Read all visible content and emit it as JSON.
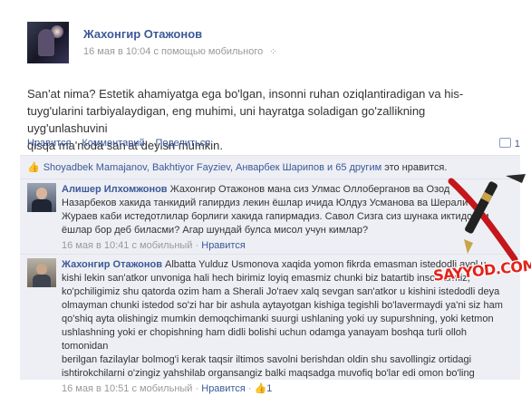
{
  "post": {
    "author": "Жахонгир Отажонов",
    "time": "16 мая в 10:04",
    "via": "с помощью мобильного",
    "text_line1": "San'at nima? Estetik ahamiyatga ega bo'lgan, insonni ruhan oziqlantiradigan va his-",
    "text_line2": "tuyg'ularini tarbiyalaydigan, eng muhimi, uni hayratga soladigan go'zallikning uyg'unlashuvini",
    "text_line3": "qisqa ma'noda san'at deyish mumkin."
  },
  "actions": {
    "like": "Нравится",
    "comment": "Комментарий",
    "share": "Поделиться",
    "share_count": "1"
  },
  "likes": {
    "names": "Shoyadbek Mamajanov, Bakhtiyor Fayziev, Анварбек Шарипов и 65 другим",
    "suffix": "это нравится."
  },
  "comments": [
    {
      "author": "Алишер Илхомжонов",
      "line1": "Жахонгир Отажонов мана сиз Улмас Оллоберганов ва Озод",
      "line2": "Назарбеков хакида танкидий гапирдиз лекин ёшлар ичида Юлдуз Усманова ва Шерали",
      "line3": "Жураев каби истедотлилар борлиги хакида гапирмадиз. Савол Сизга сиз шунака иктидорли",
      "line4": "ёшлар бор деб биласми? Агар шундай булса мисол учун кимлар?",
      "time": "16 мая в 10:41",
      "via": "с мобильный",
      "like": "Нравится"
    },
    {
      "author": "Жахонгир Отажонов",
      "line1": "Albatta Yulduz Usmonova xaqida yomon fikrda emasman istedodli ayol u",
      "line2": "kishi lekin san'atkor unvoniga hali hech birimiz loyiq emasmiz chunki biz batartib insonlarmiz,",
      "line3": "ko'pchiligimiz shu qatorda ozim ham a Sherali Jo'raev xalq sevgan san'atkor u kishini istedodli deya",
      "line4": "olmayman chunki istedod so'zi har bir ashula aytayotgan kishiga tegishli bo'lavermaydi ya'ni siz ham",
      "line5": "qo'shiq ayta olishingiz mumkin demoqchimanki suurgi ushlaning yoki uy supurshning, yoki ketmon",
      "line6": "ushlashning yoki er chopishning ham didli bolishi uchun odamga yanayam boshqa turli olloh tomonidan",
      "line7": "berilgan fazilaylar bolmog'i kerak taqsir iltimos savolni berishdan oldin shu savollingiz ortidagi",
      "line8": "ishtirokchilarni o'zingiz yahshilab organsangiz balki maqsadga muvofiq bo'lar edi omon bo'ling",
      "time": "16 мая в 10:51",
      "via": "с мобильный",
      "like": "Нравится",
      "like_count": "1"
    }
  ],
  "watermark": "SAYYOD.COM",
  "colors": {
    "link": "#3b5998",
    "ufi_bg": "#edeff4",
    "watermark": "#e2231a"
  }
}
